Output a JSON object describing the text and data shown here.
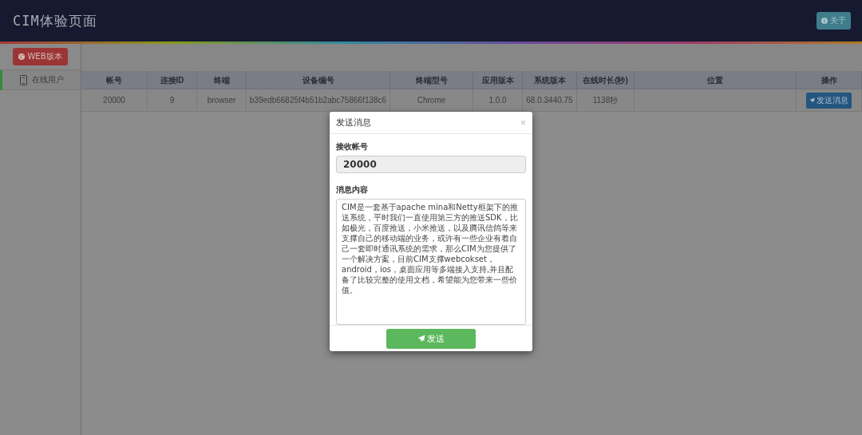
{
  "header": {
    "title": "CIM体验页面",
    "about_button": "关于"
  },
  "sidebar": {
    "web_button": "WEB版本",
    "items": [
      {
        "label": "在线用户",
        "selected": true
      }
    ]
  },
  "table": {
    "columns": [
      "帐号",
      "连接ID",
      "终端",
      "设备编号",
      "终端型号",
      "应用版本",
      "系统版本",
      "在线时长(秒)",
      "位置",
      "操作"
    ],
    "rows": [
      {
        "cells": [
          "20000",
          "9",
          "browser",
          "b39edb66825f4b51b2abc75866f138c6",
          "Chrome",
          "1.0.0",
          "68.0.3440.75",
          "1138秒",
          ""
        ],
        "action": "发送消息"
      }
    ]
  },
  "modal": {
    "title": "发送消息",
    "close": "×",
    "account_label": "接收帐号",
    "account_value": "20000",
    "content_label": "消息内容",
    "content_value": "CIM是一套基于apache mina和Netty框架下的推送系统，平时我们一直使用第三方的推送SDK，比如极光，百度推送，小米推送，以及腾讯信鸽等来支撑自己的移动端的业务，或许有一些企业有着自己一套即时通讯系统的需求，那么CIM为您提供了一个解决方案，目前CIM支撑webcokset，android，ios，桌面应用等多端接入支持,并且配备了比较完整的使用文档，希望能为您带来一些价值。",
    "send_button": "发送"
  }
}
